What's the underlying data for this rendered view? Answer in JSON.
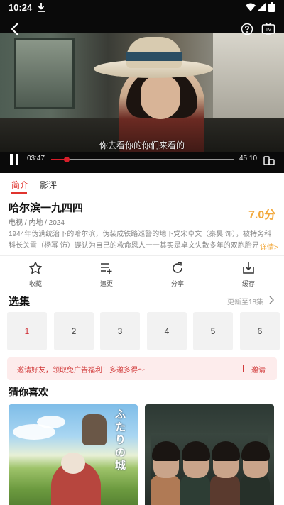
{
  "status_bar": {
    "time": "10:24"
  },
  "player": {
    "subtitle": "你去看你的你们来看的",
    "current_time": "03:47",
    "duration": "45:10",
    "progress": 0.084
  },
  "tabs": [
    {
      "label": "简介",
      "active": true
    },
    {
      "label": "影评",
      "active": false
    }
  ],
  "info": {
    "title": "哈尔滨一九四四",
    "score": "7.0分",
    "meta": "电视 / 内地 / 2024",
    "description": "1944年伪满统治下的哈尔滨，伪装成铁路巡警的地下党宋卓文（秦昊 饰），被特务科科长关雪（杨幂 饰）误认为自己的救命恩人一一其实是卓文失散多年的双胞胎兄弟",
    "more": "详情>"
  },
  "actions": [
    {
      "label": "收藏",
      "icon": "star-icon"
    },
    {
      "label": "追更",
      "icon": "playlist-add-icon"
    },
    {
      "label": "分享",
      "icon": "share-icon"
    },
    {
      "label": "缓存",
      "icon": "download-icon"
    }
  ],
  "episodes": {
    "title": "选集",
    "more": "更新至18集",
    "items": [
      "1",
      "2",
      "3",
      "4",
      "5",
      "6"
    ],
    "active_index": 0
  },
  "invite": {
    "text": "邀请好友，领取免广告福利！多邀多得～",
    "button": "邀请"
  },
  "recommend": {
    "title": "猜你喜欢",
    "poster1_text": "ふたりの城"
  },
  "colors": {
    "accent": "#e0342e",
    "score": "#f2a83b",
    "invite_bg": "#fdecec"
  }
}
